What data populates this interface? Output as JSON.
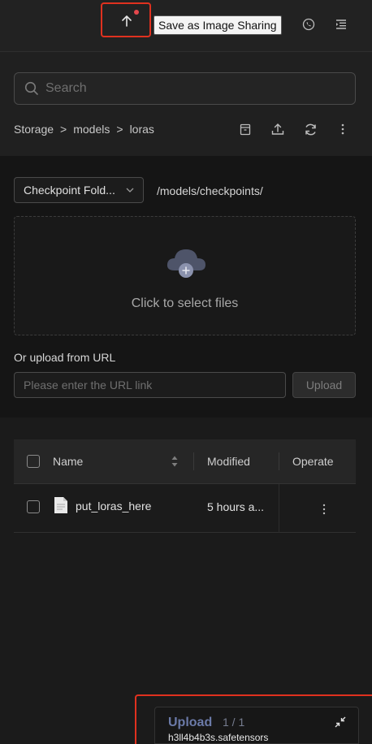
{
  "header": {
    "tooltip": "Save as Image Sharing",
    "icons": [
      "arrow-up-icon",
      "whatsapp-icon",
      "menu-fold-icon"
    ],
    "notification_color": "#e5484d",
    "highlight_color": "#e0311f"
  },
  "search": {
    "placeholder": "Search"
  },
  "breadcrumb": {
    "items": [
      "Storage",
      ">",
      "models",
      ">",
      "loras"
    ]
  },
  "toolbar": {
    "icons": [
      "archive-icon",
      "upload-icon",
      "refresh-icon",
      "more-vertical-icon"
    ]
  },
  "upload_panel": {
    "folder_select": "Checkpoint Fold...",
    "folder_path": "/models/checkpoints/",
    "dropzone_hint": "Click to select files",
    "url_label": "Or upload from URL",
    "url_placeholder": "Please enter the URL link",
    "upload_button": "Upload"
  },
  "table": {
    "columns": [
      "Name",
      "Modified",
      "Operate"
    ],
    "rows": [
      {
        "name": "put_loras_here",
        "modified": "5 hours a..."
      }
    ]
  },
  "upload_progress": {
    "title": "Upload",
    "count": "1 / 1",
    "file": "h3ll4b4b3s.safetensors"
  }
}
